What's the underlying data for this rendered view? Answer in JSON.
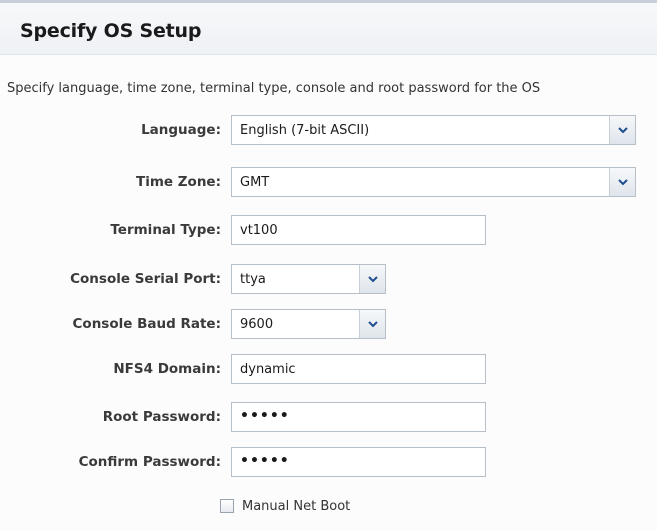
{
  "header": {
    "title": "Specify OS Setup"
  },
  "description": "Specify language, time zone, terminal type, console and root password for the OS",
  "form": {
    "language": {
      "label": "Language:",
      "value": "English (7-bit ASCII)"
    },
    "time_zone": {
      "label": "Time Zone:",
      "value": "GMT"
    },
    "terminal_type": {
      "label": "Terminal Type:",
      "value": "vt100"
    },
    "console_serial_port": {
      "label": "Console Serial Port:",
      "value": "ttya"
    },
    "console_baud_rate": {
      "label": "Console Baud Rate:",
      "value": "9600"
    },
    "nfs4_domain": {
      "label": "NFS4 Domain:",
      "value": "dynamic"
    },
    "root_password": {
      "label": "Root Password:",
      "value": "•••••"
    },
    "confirm_password": {
      "label": "Confirm Password:",
      "value": "•••••"
    },
    "manual_net_boot": {
      "label": "Manual Net Boot",
      "checked": false
    }
  },
  "icons": {
    "dropdown": "chevron-down-icon"
  },
  "colors": {
    "field_border": "#b7bfc9",
    "chevron": "#1f4f8f"
  }
}
